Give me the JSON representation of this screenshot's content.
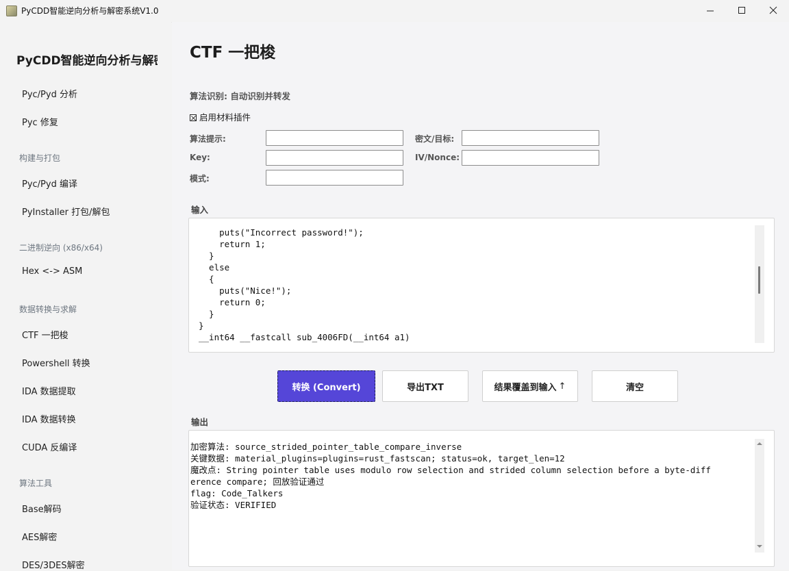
{
  "window": {
    "title": "PyCDD智能逆向分析与解密系统V1.0",
    "icon": "app-icon",
    "controls": [
      "minimize-icon",
      "maximize-icon",
      "close-icon"
    ]
  },
  "sidebar": {
    "title": "PyCDD智能逆向分析与解密系统",
    "groups": [
      {
        "items": [
          "Pyc/Pyd 分析",
          "Pyc 修复"
        ]
      },
      {
        "section": "构建与打包",
        "items": [
          "Pyc/Pyd 编译",
          "PyInstaller 打包/解包"
        ]
      },
      {
        "section": "二进制逆向 (x86/x64)",
        "items": [
          "Hex <-> ASM"
        ]
      },
      {
        "section": "数据转换与求解",
        "items": [
          "CTF 一把梭",
          "Powershell 转换",
          "IDA 数据提取",
          "IDA 数据转换",
          "CUDA 反编译"
        ]
      },
      {
        "section": "算法工具",
        "items": [
          "Base解码",
          "AES解密",
          "DES/3DES解密"
        ]
      }
    ]
  },
  "main": {
    "title": "CTF 一把梭",
    "algo_detect": "算法识别: 自动识别并转发",
    "plugin_checkbox": {
      "label": "启用材料插件",
      "checked": true
    },
    "fields": {
      "hint_label": "算法提示:",
      "hint_value": "",
      "cipher_label": "密文/目标:",
      "cipher_value": "",
      "key_label": "Key:",
      "key_value": "",
      "iv_label": "IV/Nonce:",
      "iv_value": "",
      "mode_label": "模式:",
      "mode_value": ""
    },
    "input_label": "输入",
    "input_code": "    puts(\"Incorrect password!\");\n    return 1;\n  }\n  else\n  {\n    puts(\"Nice!\");\n    return 0;\n  }\n}\n__int64 __fastcall sub_4006FD(__int64 a1)",
    "buttons": {
      "convert": "转换 (Convert)",
      "export": "导出TXT",
      "overwrite": "结果覆盖到输入",
      "overwrite_arrow": "↑",
      "clear": "清空"
    },
    "output_label": "输出",
    "output_text": "加密算法: source_strided_pointer_table_compare_inverse\n关键数据: material_plugins=plugins=rust_fastscan; status=ok, target_len=12\n魔改点: String pointer table uses modulo row selection and strided column selection before a byte-diff\nerence compare; 回放验证通过\nflag: Code_Talkers\n验证状态: VERIFIED"
  },
  "colors": {
    "primary_button": "#5546d8",
    "background": "#f3f3f3",
    "panel": "#ffffff"
  }
}
